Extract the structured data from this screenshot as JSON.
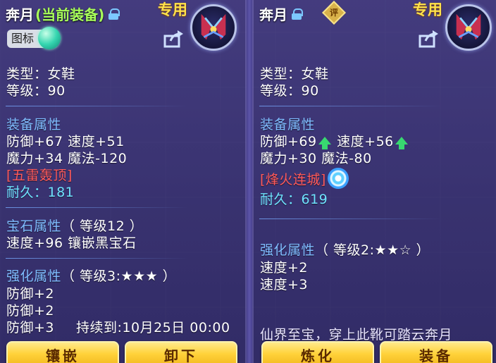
{
  "left": {
    "title": "奔月",
    "title_suffix": "(当前装备)",
    "exclusive": "专用",
    "icon_badge": "图标",
    "type": "类型：女鞋",
    "level": "等级：90",
    "equip_attr_title": "装备属性",
    "attr_line1": "防御+67 速度+51",
    "attr_line2": "魔力+34 魔法-120",
    "special": "[五雷轰顶]",
    "durability": "耐久：181",
    "gem_title": "宝石属性",
    "gem_level": "（ 等级12 ）",
    "gem_line": "速度+96 镶嵌黑宝石",
    "enhance_title": "强化属性",
    "enhance_level": "（ 等级3:★★★ ）",
    "enhance_lines": [
      "防御+2",
      "防御+2",
      "防御+3"
    ],
    "duration": "持续到:10月25日 00:00",
    "btn_left": "镶嵌",
    "btn_right": "卸下"
  },
  "right": {
    "title": "奔月",
    "rating_icon": "评",
    "exclusive": "专用",
    "type": "类型：女鞋",
    "level": "等级：90",
    "equip_attr_title": "装备属性",
    "def": "防御+69",
    "spd": "速度+56",
    "attr_line2": "魔力+30 魔法-80",
    "special": "[烽火连城]",
    "durability": "耐久：619",
    "enhance_title": "强化属性",
    "enhance_level": "（ 等级2:★★☆ ）",
    "enhance_lines": [
      "速度+2",
      "速度+3"
    ],
    "flavor": "仙界至宝，穿上此靴可踏云奔月",
    "btn_left": "炼化",
    "btn_right": "装备"
  },
  "colors": {
    "section": "#7fbcff",
    "special": "#ff5a5a",
    "durability": "#6fe3ff",
    "button": "#ffd23a",
    "up_arrow": "#38d870"
  },
  "icons": [
    "lock-icon",
    "share-icon",
    "up-arrow-icon",
    "swirl-icon",
    "gem-orb-icon",
    "emblem-icon"
  ]
}
